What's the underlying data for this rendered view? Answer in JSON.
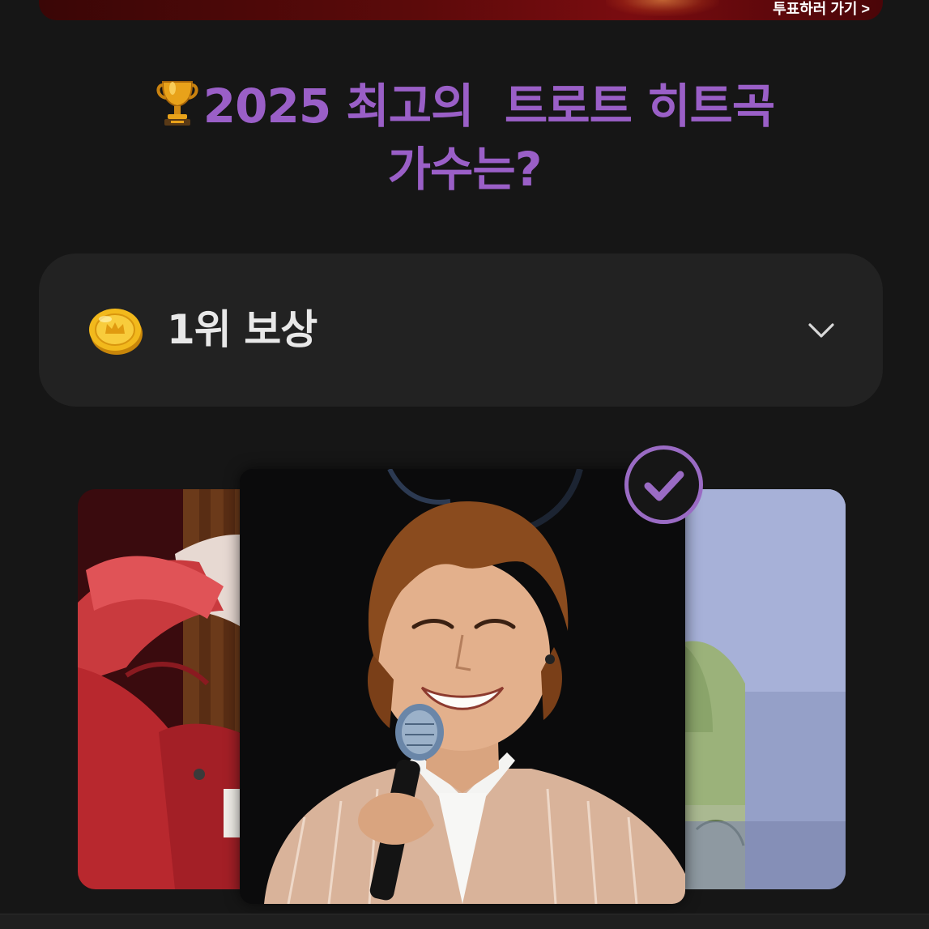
{
  "banner": {
    "link_text": "투표하러 가기 >"
  },
  "title": {
    "line1": "2025 최고의  트로트 히트곡",
    "line2": "가수는?",
    "icon": "trophy-icon",
    "color": "#9a5fc7"
  },
  "reward": {
    "label": "1위 보상",
    "icon": "coin-icon",
    "toggle_icon": "chevron-down-icon"
  },
  "carousel": {
    "items": [
      {
        "position": "left",
        "image": "singer-photo-red-outfit"
      },
      {
        "position": "center",
        "image": "singer-photo-microphone",
        "selected": true
      },
      {
        "position": "right",
        "image": "singer-photo-green-jacket"
      }
    ],
    "selected_icon": "check-circle-icon",
    "accent": "#9a6bc4"
  }
}
